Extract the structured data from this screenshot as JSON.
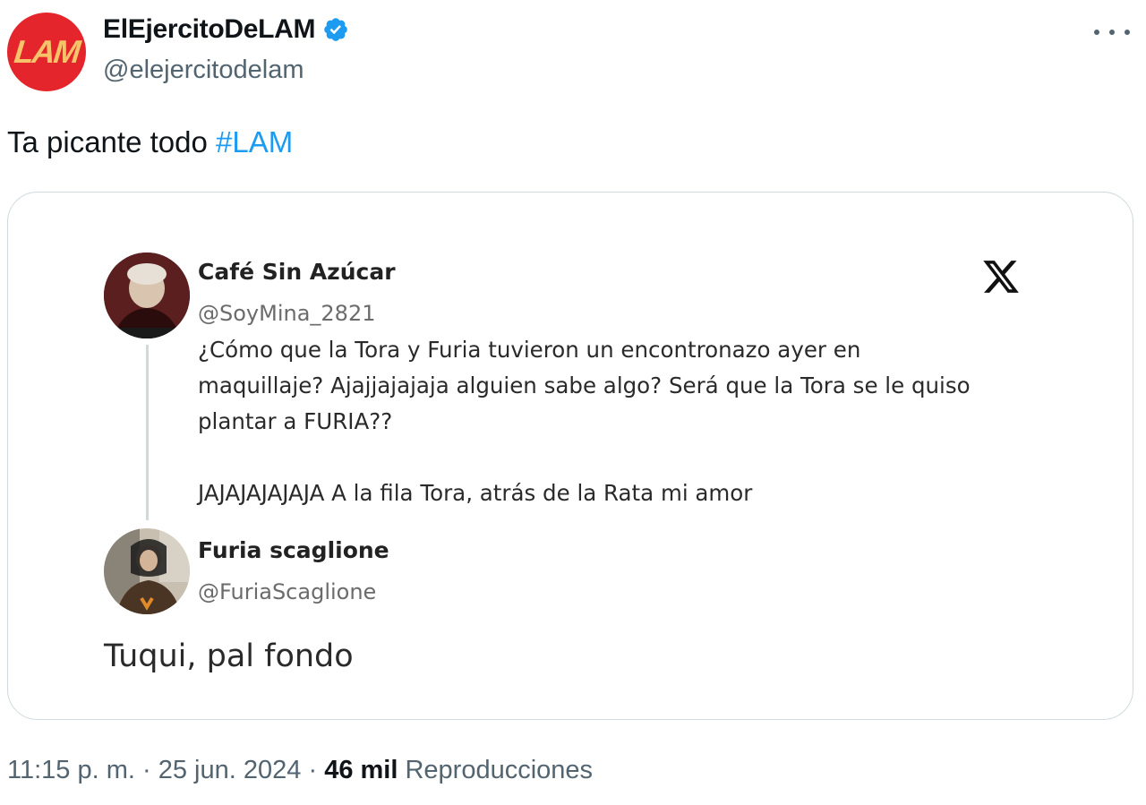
{
  "author": {
    "avatar_text": "LAM",
    "display_name": "ElEjercitoDeLAM",
    "handle": "@elejercitodelam",
    "verified": true,
    "avatar_color": "#e4252b"
  },
  "post": {
    "text": "Ta picante todo",
    "hashtag": "#LAM",
    "hashtag_color": "#1d9bf0"
  },
  "media": {
    "first_tweet": {
      "display_name": "Café Sin Azúcar",
      "handle": "@SoyMina_2821",
      "line1": "¿Cómo que la Tora y Furia tuvieron un encontronazo ayer en",
      "line2": "maquillaje? Ajajjajajaja alguien sabe algo? Será que la Tora se le quiso",
      "line3": "plantar a FURIA??",
      "line4": "JAJAJAJAJAJA A la fila Tora, atrás de la Rata mi amor"
    },
    "reply_tweet": {
      "display_name": "Furia scaglione",
      "handle": "@FuriaScaglione",
      "text": "Tuqui, pal fondo"
    },
    "platform_icon": "x-logo-icon"
  },
  "meta": {
    "time": "11:15 p. m.",
    "separator": "·",
    "date": "25 jun. 2024",
    "views_count": "46 mil",
    "views_label": "Reproducciones"
  },
  "icons": {
    "more": "more-options-icon",
    "verified": "verified-badge-icon"
  }
}
